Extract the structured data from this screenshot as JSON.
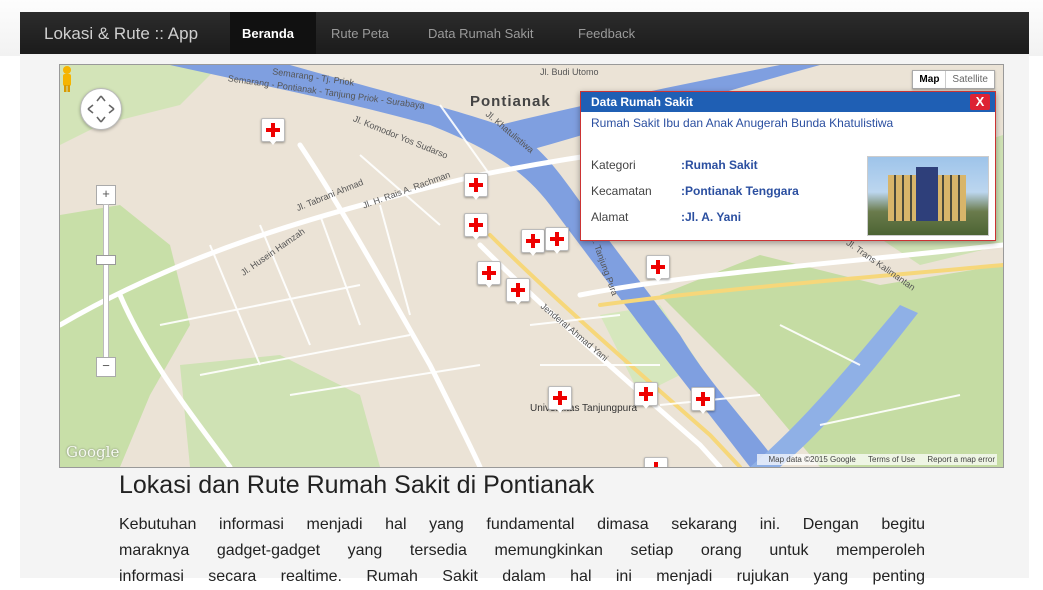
{
  "navbar": {
    "brand": "Lokasi & Rute :: App",
    "items": [
      {
        "label": "Beranda",
        "active": true
      },
      {
        "label": "Rute Peta",
        "active": false
      },
      {
        "label": "Data Rumah Sakit",
        "active": false
      },
      {
        "label": "Feedback",
        "active": false
      }
    ]
  },
  "map": {
    "type_buttons": {
      "map": "Map",
      "satellite": "Satellite"
    },
    "city_label": "Pontianak",
    "landmark_label": "Universitas Tanjungpura",
    "street_labels": [
      "Semarang - Tj. Priok",
      "Semarang - Pontianak - Tanjung Priok - Surabaya",
      "Jl. Komodor Yos Sudarso",
      "Jl. Khatulistiwa",
      "Jl. H. Rais A. Rachman",
      "Jl. Tabrani Ahmad",
      "Jl. Husein Hamzah",
      "Jenderal Ahmad Yani",
      "Jl. Tanjung Pura",
      "Jl. Trans Kalimantan",
      "Jl. Budi Utomo"
    ],
    "logo": "Google",
    "attribution": "Map data ©2015 Google",
    "terms": "Terms of Use",
    "report": "Report a map error",
    "info_window": {
      "header": "Data Rumah Sakit",
      "close_glyph": "X",
      "hospital_name": "Rumah Sakit Ibu dan Anak Anugerah Bunda Khatulistiwa",
      "fields": [
        {
          "key": "Kategori",
          "value": ":Rumah Sakit"
        },
        {
          "key": "Kecamatan",
          "value": ":Pontianak Tenggara"
        },
        {
          "key": "Alamat",
          "value": ":Jl. A. Yani"
        }
      ]
    }
  },
  "content": {
    "title": "Lokasi dan Rute Rumah Sakit di Pontianak",
    "paragraph_lines": [
      "Kebutuhan informasi menjadi hal yang fundamental dimasa sekarang ini. Dengan begitu",
      "maraknya gadget-gadget yang tersedia memungkinkan setiap orang untuk memperoleh",
      "informasi secara realtime. Rumah Sakit dalam hal ini menjadi rujukan yang penting"
    ]
  },
  "colors": {
    "navbar_bg": "#1b1b1b",
    "info_header": "#1f5fb4",
    "marker_cross": "#ee0000",
    "river": "#7f9fe0"
  }
}
